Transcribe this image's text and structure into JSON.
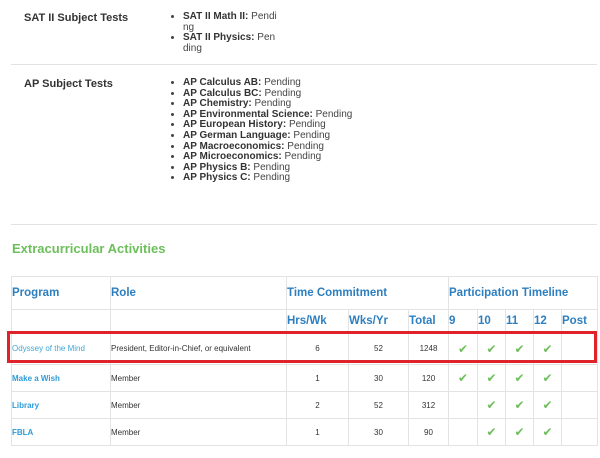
{
  "sat_subject": {
    "label": "SAT II Subject Tests",
    "items": [
      {
        "name": "SAT II Math II:",
        "status": "Pending"
      },
      {
        "name": "SAT II Physics:",
        "status": "Pending"
      }
    ]
  },
  "ap_subject": {
    "label": "AP Subject Tests",
    "items": [
      {
        "name": "AP Calculus AB:",
        "status": "Pending"
      },
      {
        "name": "AP Calculus BC:",
        "status": "Pending"
      },
      {
        "name": "AP Chemistry:",
        "status": "Pending"
      },
      {
        "name": "AP Environmental Science:",
        "status": "Pending"
      },
      {
        "name": "AP European History:",
        "status": "Pending"
      },
      {
        "name": "AP German Language:",
        "status": "Pending"
      },
      {
        "name": "AP Macroeconomics:",
        "status": "Pending"
      },
      {
        "name": "AP Microeconomics:",
        "status": "Pending"
      },
      {
        "name": "AP Physics B:",
        "status": "Pending"
      },
      {
        "name": "AP Physics C:",
        "status": "Pending"
      }
    ]
  },
  "extracurricular": {
    "title": "Extracurricular Activities",
    "headers": {
      "program": "Program",
      "role": "Role",
      "time_commitment": "Time Commitment",
      "participation_timeline": "Participation Timeline",
      "hrs_wk": "Hrs/Wk",
      "wks_yr": "Wks/Yr",
      "total": "Total",
      "g9": "9",
      "g10": "10",
      "g11": "11",
      "g12": "12",
      "post": "Post"
    },
    "check_glyph": "✔",
    "rows": [
      {
        "program": "Odyssey of the Mind",
        "role": "President, Editor-in-Chief, or equivalent",
        "hrs_wk": "6",
        "wks_yr": "52",
        "total": "1248",
        "timeline": [
          true,
          true,
          true,
          true,
          false
        ]
      },
      {
        "program": "Make a Wish",
        "role": "Member",
        "hrs_wk": "1",
        "wks_yr": "30",
        "total": "120",
        "timeline": [
          true,
          true,
          true,
          true,
          false
        ]
      },
      {
        "program": "Library",
        "role": "Member",
        "hrs_wk": "2",
        "wks_yr": "52",
        "total": "312",
        "timeline": [
          false,
          true,
          true,
          true,
          false
        ]
      },
      {
        "program": "FBLA",
        "role": "Member",
        "hrs_wk": "1",
        "wks_yr": "30",
        "total": "90",
        "timeline": [
          false,
          true,
          true,
          true,
          false
        ]
      }
    ]
  },
  "colors": {
    "accent_green": "#6cbf5a",
    "header_blue": "#2e7fbf",
    "link_blue": "#2e9bd6",
    "highlight_red": "#e0232a"
  }
}
